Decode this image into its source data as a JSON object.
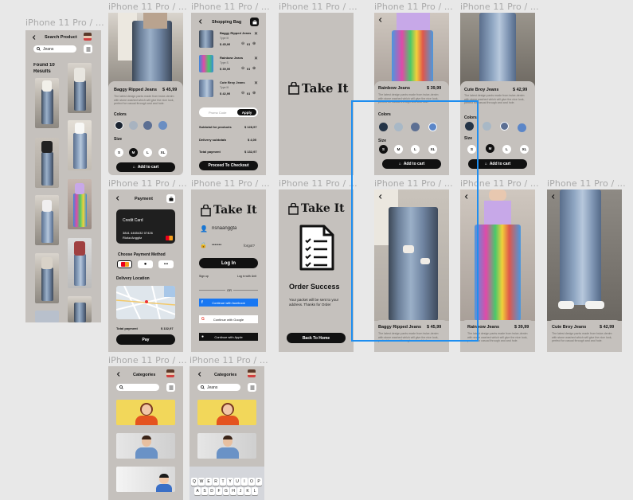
{
  "frame_label": "iPhone 11 Pro / ...",
  "search": {
    "title": "Search Product",
    "query": "Jeans",
    "found": "Found 10",
    "results": "Results"
  },
  "product": {
    "baggy": {
      "name": "Baggy Ripped Jeans",
      "price": "$ 45,99"
    },
    "rainbow": {
      "name": "Rainbow Jeans",
      "price": "$ 39,99"
    },
    "cute": {
      "name": "Cute Broy Jeans",
      "price": "$ 42,99"
    },
    "desc": "The latest design pants made from twice-denim with stone washed which will give the nice look, perfect for casual through and and hole.",
    "colors_label": "Colors",
    "size_label": "Size",
    "sizes": [
      "S",
      "M",
      "L",
      "XL"
    ],
    "add_to_cart": "Add to cart"
  },
  "bag": {
    "title": "Shopping Bag",
    "items": [
      {
        "name": "Baggy Ripped Jeans",
        "type": "Type M",
        "price": "$ 45,99",
        "qty": "01"
      },
      {
        "name": "Rainbow Jeans",
        "type": "Type S",
        "price": "$ 39,99",
        "qty": "01"
      },
      {
        "name": "Cute Broy Jeans",
        "type": "Type M",
        "price": "$ 42,99",
        "qty": "01"
      }
    ],
    "promo_placeholder": "Promo Code",
    "apply": "Apply",
    "subtotal_label": "Subtotal for products",
    "subtotal": "$ 128,97",
    "delivery_label": "Delivery subtotals",
    "delivery": "$ 4,00",
    "total_label": "Total payment",
    "total": "$ 132,97",
    "checkout": "Proceed To Checkout"
  },
  "brand": {
    "name": "Take It",
    "bag_text": "TI"
  },
  "payment": {
    "title": "Payment",
    "card_title": "Credit Card",
    "card_number": "3841 4465432 07426",
    "card_name": "Rizka Anggita",
    "method_label": "Choose Payment Method",
    "more": "•••",
    "delivery_label": "Delivery Location",
    "total_label": "Total payment",
    "total": "$ 132,97",
    "pay": "Pay"
  },
  "login": {
    "username": "risnaanggta",
    "password": "•••••••",
    "forgot": "forgot?",
    "login": "Log In",
    "signup": "Sign up",
    "login_with": "Log in with Unit",
    "or": "OR",
    "facebook": "Continue with facebook",
    "google": "Continue with Google",
    "apple": "Continue with Apple"
  },
  "order": {
    "title": "Order Success",
    "message": "Your packet will be sent to your address. Thanks for Order",
    "back": "Back To Home"
  },
  "categories": {
    "title": "Categories",
    "query": "Jeans"
  },
  "keyboard": {
    "row1": [
      "Q",
      "W",
      "E",
      "R",
      "T",
      "Y",
      "U",
      "I",
      "O",
      "P"
    ],
    "row2": [
      "A",
      "S",
      "D",
      "F",
      "G",
      "H",
      "J",
      "K",
      "L"
    ]
  },
  "colors": {
    "accent_blue": "#1e8ef0",
    "frame_bg": "#c5c1bd",
    "canvas_bg": "#e8e8e8",
    "dark": "#111111",
    "facebook": "#1877f2"
  }
}
